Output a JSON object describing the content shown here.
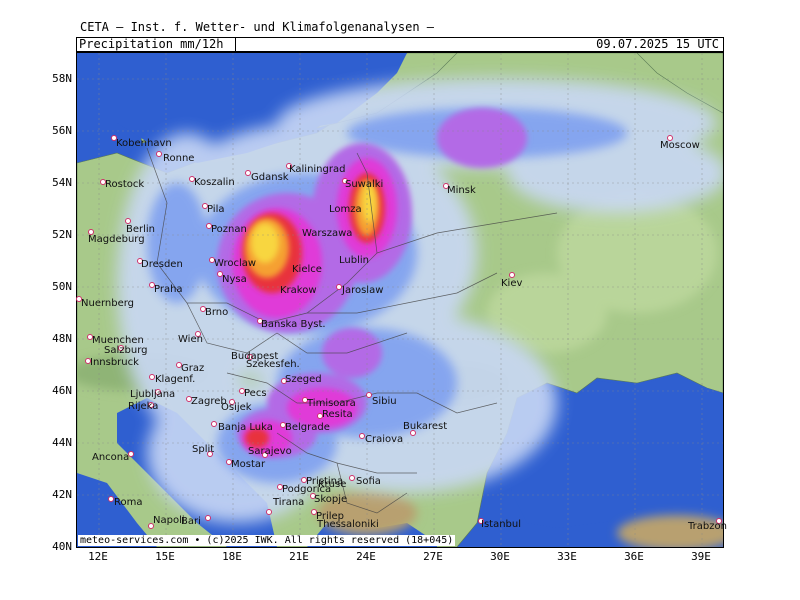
{
  "header": {
    "title": "CETA — Inst. f. Wetter- und Klimafolgenanalysen —",
    "parameter": "Precipitation  mm/12h",
    "datetime": "09.07.2025 15 UTC"
  },
  "axes": {
    "lat_labels": [
      "58N",
      "56N",
      "54N",
      "52N",
      "50N",
      "48N",
      "46N",
      "44N",
      "42N",
      "40N"
    ],
    "lon_labels": [
      "12E",
      "15E",
      "18E",
      "21E",
      "24E",
      "27E",
      "30E",
      "33E",
      "36E",
      "39E"
    ]
  },
  "footer": "meteo-services.com • (c)2025 IWK. All rights reserved (18+045)",
  "cities": [
    {
      "name": "Kobenhavn"
    },
    {
      "name": "Ronne"
    },
    {
      "name": "Rostock"
    },
    {
      "name": "Koszalin"
    },
    {
      "name": "Gdansk"
    },
    {
      "name": "Kaliningrad"
    },
    {
      "name": "Suwalki"
    },
    {
      "name": "Minsk"
    },
    {
      "name": "Moscow"
    },
    {
      "name": "Berlin"
    },
    {
      "name": "Magdeburg"
    },
    {
      "name": "Pila"
    },
    {
      "name": "Poznan"
    },
    {
      "name": "Lomza"
    },
    {
      "name": "Warszawa"
    },
    {
      "name": "Lublin"
    },
    {
      "name": "Dresden"
    },
    {
      "name": "Wroclaw"
    },
    {
      "name": "Nysa"
    },
    {
      "name": "Kielce"
    },
    {
      "name": "Praha"
    },
    {
      "name": "Krakow"
    },
    {
      "name": "Jaroslaw"
    },
    {
      "name": "Kiev"
    },
    {
      "name": "Nuernberg"
    },
    {
      "name": "Brno"
    },
    {
      "name": "Banska Byst."
    },
    {
      "name": "Wien"
    },
    {
      "name": "Muenchen"
    },
    {
      "name": "Salzburg"
    },
    {
      "name": "Budapest"
    },
    {
      "name": "Szekesfeh."
    },
    {
      "name": "Innsbruck"
    },
    {
      "name": "Graz"
    },
    {
      "name": "Klagenf."
    },
    {
      "name": "Szeged"
    },
    {
      "name": "Ljubljana"
    },
    {
      "name": "Pecs"
    },
    {
      "name": "Rijeka"
    },
    {
      "name": "Zagreb"
    },
    {
      "name": "Osijek"
    },
    {
      "name": "Timisoara"
    },
    {
      "name": "Sibiu"
    },
    {
      "name": "Resita"
    },
    {
      "name": "Banja Luka"
    },
    {
      "name": "Belgrade"
    },
    {
      "name": "Bukarest"
    },
    {
      "name": "Craiova"
    },
    {
      "name": "Sarajevo"
    },
    {
      "name": "Ancona"
    },
    {
      "name": "Split"
    },
    {
      "name": "Mostar"
    },
    {
      "name": "Pristina"
    },
    {
      "name": "Podgorica"
    },
    {
      "name": "Sofia"
    },
    {
      "name": "Kruse"
    },
    {
      "name": "Skopje"
    },
    {
      "name": "Tirana"
    },
    {
      "name": "Roma"
    },
    {
      "name": "Prilep"
    },
    {
      "name": "Napoli"
    },
    {
      "name": "Bari"
    },
    {
      "name": "Thessaloniki"
    },
    {
      "name": "Istanbul"
    },
    {
      "name": "Trabzon"
    }
  ],
  "colors": {
    "sea": "#2f5fd0",
    "land": "#a8c98a",
    "precip_light": "#c9d8f5",
    "precip_mid": "#7fa0f0",
    "precip_violet": "#b36be6",
    "precip_magenta": "#e03bd8",
    "precip_red": "#e8303c",
    "precip_orange": "#f5a030",
    "precip_yellow": "#f8d640",
    "city_marker": "#d0306a"
  }
}
